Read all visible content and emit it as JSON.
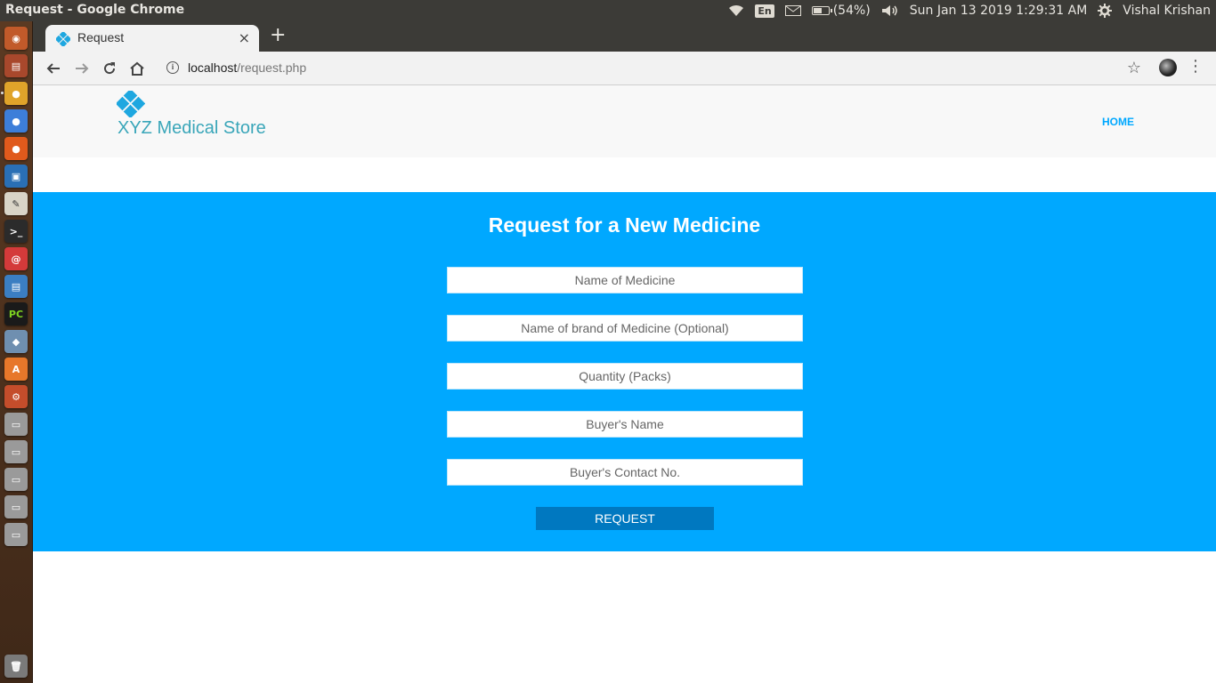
{
  "os_panel": {
    "window_title": "Request - Google Chrome",
    "input_method": "En",
    "battery_label": "(54%)",
    "battery_level": 0.54,
    "datetime": "Sun Jan 13 2019  1:29:31 AM",
    "user_name": "Vishal Krishan",
    "icons": [
      "wifi-icon",
      "keyboard-language-icon",
      "mail-icon",
      "battery-icon",
      "volume-icon",
      "settings-gear-icon"
    ]
  },
  "launcher": {
    "items": [
      "ubuntu-dash",
      "files",
      "chrome",
      "chromium",
      "firefox",
      "virtualbox",
      "text-editor",
      "terminal",
      "debian-app",
      "libreoffice-writer",
      "pycharm",
      "cube-app",
      "software-center",
      "system-settings",
      "drive-1",
      "drive-2",
      "drive-3",
      "drive-4",
      "drive-5",
      "trash"
    ]
  },
  "browser": {
    "tab": {
      "title": "Request",
      "close": "×"
    },
    "new_tab": "+",
    "url_host": "localhost",
    "url_path": "/request.php"
  },
  "site": {
    "brand_name": "XYZ Medical Store",
    "nav_home": "HOME"
  },
  "form": {
    "title": "Request for a New Medicine",
    "fields": {
      "medicine_name": "Name of Medicine",
      "brand_name": "Name of brand of Medicine (Optional)",
      "quantity": "Quantity (Packs)",
      "buyer_name": "Buyer's Name",
      "buyer_contact": "Buyer's Contact No."
    },
    "submit_label": "REQUEST"
  },
  "colors": {
    "accent": "#00a8ff",
    "button": "#0078c0",
    "brand_text": "#3aa6b9",
    "header_bg": "#f8f8f8"
  }
}
